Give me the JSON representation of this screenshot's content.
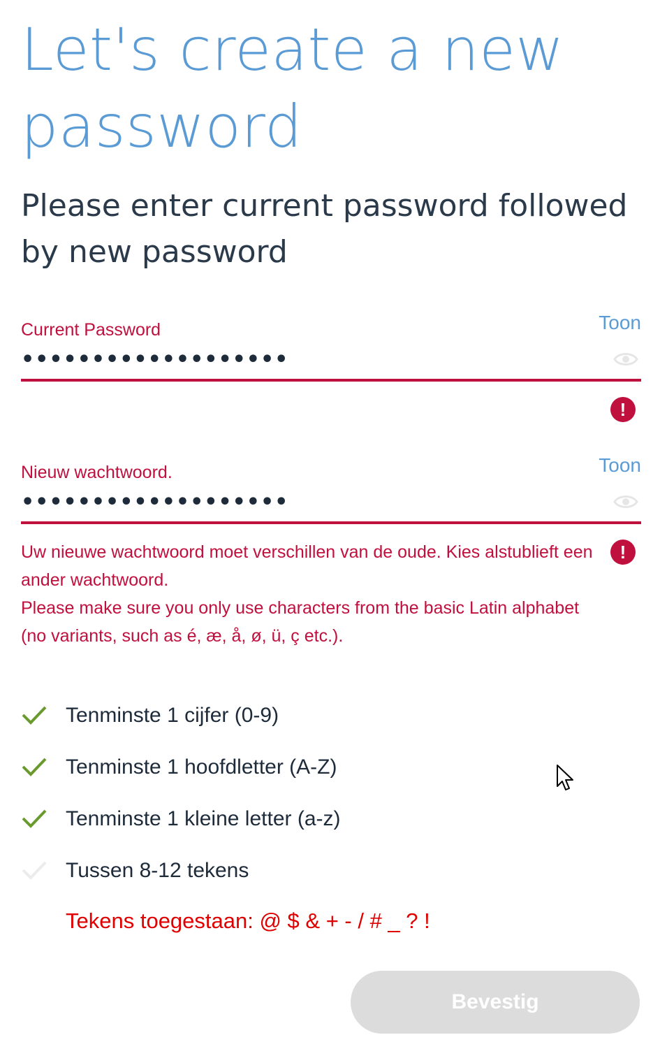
{
  "header": {
    "title": "Let's create a new password",
    "subtitle": "Please enter current password followed by new password"
  },
  "current_password": {
    "label": "Current Password",
    "toggle_label": "Toon",
    "value": "•••••••••••••••••••",
    "has_error": true
  },
  "new_password": {
    "label": "Nieuw wachtwoord.",
    "toggle_label": "Toon",
    "value": "•••••••••••••••••••",
    "has_error": true,
    "errors": [
      "Uw nieuwe wachtwoord moet verschillen van de oude. Kies alstublieft een ander wachtwoord.",
      "Please make sure you only use characters from the basic Latin alphabet (no variants, such as é, æ, å, ø, ü, ç etc.)."
    ]
  },
  "requirements": [
    {
      "label": "Tenminste 1 cijfer (0-9)",
      "met": true
    },
    {
      "label": "Tenminste 1 hoofdletter (A-Z)",
      "met": true
    },
    {
      "label": "Tenminste 1 kleine letter (a-z)",
      "met": true
    },
    {
      "label": "Tussen 8-12 tekens",
      "met": false
    }
  ],
  "allowed_characters": "Tekens toegestaan: @ $ & + - / # _ ? !",
  "actions": {
    "confirm_label": "Bevestig",
    "confirm_enabled": false
  },
  "colors": {
    "title_blue": "#5b9bd5",
    "error_red": "#c0103d",
    "allowed_red": "#e00000",
    "check_green": "#6a9a2e",
    "check_inactive": "#ececec",
    "button_disabled": "#dcdcdc"
  },
  "icons": {
    "toggle_visibility": "eye-icon",
    "error": "exclamation-circle-icon",
    "requirement": "checkmark-icon",
    "pointer": "mouse-cursor-icon"
  }
}
